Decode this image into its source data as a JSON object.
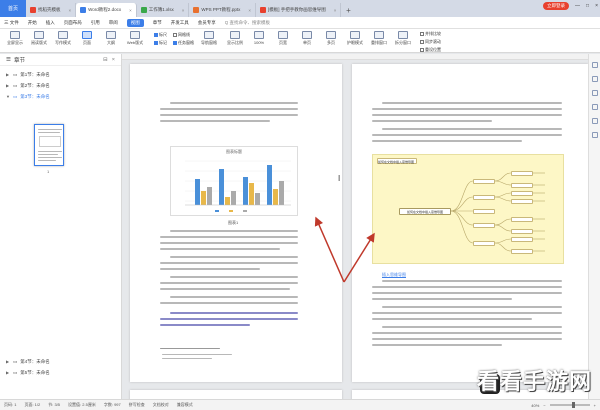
{
  "tabs": {
    "home": "首页",
    "items": [
      {
        "label": "找稻壳模板",
        "color": "#e8402e",
        "active": false
      },
      {
        "label": "Word教程2.docx",
        "color": "#3c7ee8",
        "active": true
      },
      {
        "label": "工作簿1.xlsx",
        "color": "#3aa84a",
        "active": false
      },
      {
        "label": "WPS PPT教程.pptx",
        "color": "#e8702e",
        "active": false
      },
      {
        "label": "[模板] 手把手教你画思维导图",
        "color": "#e8402e",
        "active": false
      }
    ],
    "login": "立即登录"
  },
  "menu": {
    "items": [
      "三 文件",
      "开始",
      "插入",
      "页面布局",
      "引用",
      "审阅",
      "视图",
      "章节",
      "开发工具",
      "会员专享"
    ],
    "active": "视图",
    "search": "Q 查找命令、搜索模板"
  },
  "toolbar": {
    "buttons": [
      "全屏显示",
      "阅读版式",
      "写作模式",
      "页面",
      "大纲",
      "Web版式"
    ],
    "active": "页面",
    "checks": [
      {
        "label": "标尺",
        "checked": true
      },
      {
        "label": "网格线",
        "checked": false
      },
      {
        "label": "标记",
        "checked": true
      },
      {
        "label": "任务窗格",
        "checked": true
      }
    ],
    "nav_button": "导航窗格",
    "right_buttons": [
      "显示比例",
      "100%",
      "页宽",
      "单页",
      "多页",
      "护眼模式",
      "重排窗口",
      "拆分窗口",
      "并排比较",
      "同步滚动",
      "重设位置"
    ]
  },
  "sidebar": {
    "title": "章节",
    "items": [
      {
        "label": "第1节：未命名",
        "selected": false
      },
      {
        "label": "第2节：未命名",
        "selected": false
      },
      {
        "label": "第3节：未命名",
        "selected": true
      }
    ],
    "thumb_page": "1",
    "bottom_items": [
      {
        "label": "第4节：未命名"
      },
      {
        "label": "第5节：未命名"
      }
    ]
  },
  "document": {
    "chart_title": "图表标题",
    "fig_caption": "图表1",
    "mindmap_root": "如何在文档中插入思维导图",
    "mindmap_top": "如何在文档中插入思维导图",
    "left_link": "视频位置",
    "right_heading": "插入思维导图"
  },
  "status": {
    "page": "页码: 1",
    "pages": "页面: 1/2",
    "section": "节: 3/5",
    "settings": "设置值: 2.5厘米",
    "words": "字数: 997",
    "spell": "拼写检查",
    "doc_check": "文档校对",
    "compat": "兼容模式",
    "zoom": "40%"
  },
  "watermark": "看看手游网"
}
